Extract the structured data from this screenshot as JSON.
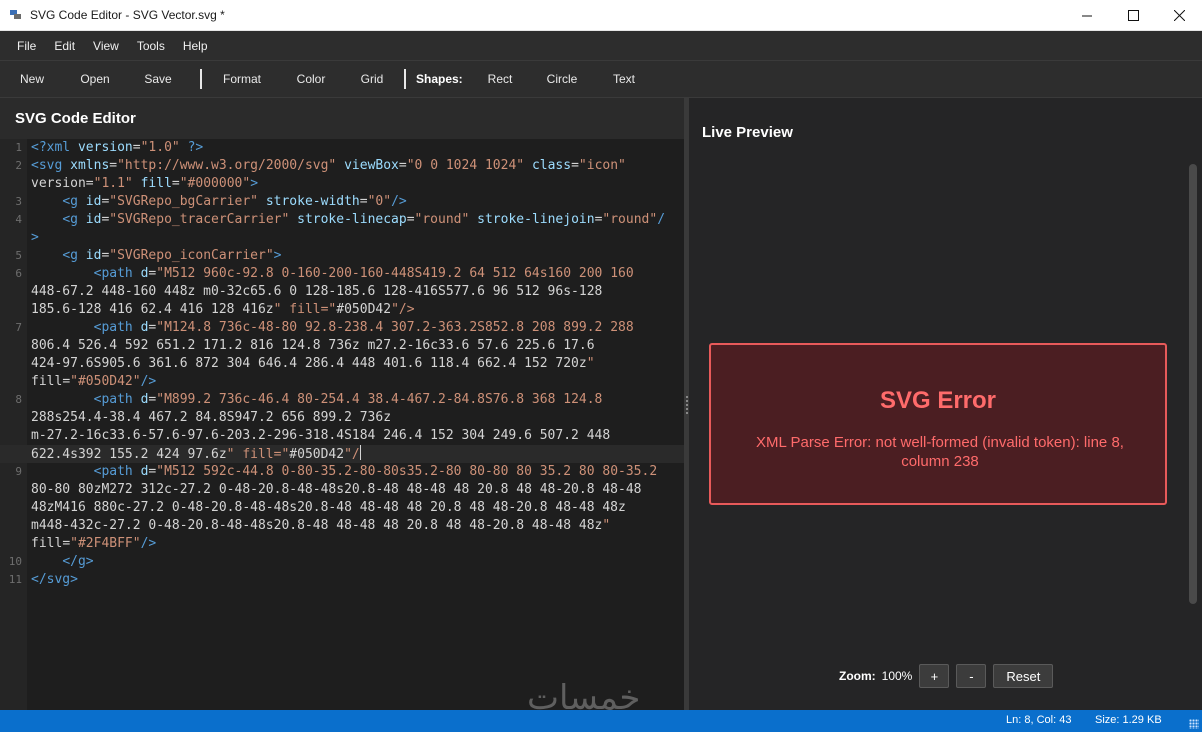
{
  "window": {
    "title": "SVG Code Editor - SVG Vector.svg *"
  },
  "menu": [
    "File",
    "Edit",
    "View",
    "Tools",
    "Help"
  ],
  "toolbar": {
    "new_label": "New",
    "open_label": "Open",
    "save_label": "Save",
    "format_label": "Format",
    "color_label": "Color",
    "grid_label": "Grid",
    "shapes_label": "Shapes:",
    "rect_label": "Rect",
    "circle_label": "Circle",
    "text_label": "Text"
  },
  "editor": {
    "title": "SVG Code Editor",
    "line_numbers": [
      "1",
      "2",
      "3",
      "4",
      "5",
      "6",
      "7",
      "8",
      "9",
      "10",
      "11"
    ],
    "lines": [
      "<?xml version=\"1.0\" ?>",
      "<svg xmlns=\"http://www.w3.org/2000/svg\" viewBox=\"0 0 1024 1024\" class=\"icon\"",
      "version=\"1.1\" fill=\"#000000\">",
      "    <g id=\"SVGRepo_bgCarrier\" stroke-width=\"0\"/>",
      "    <g id=\"SVGRepo_tracerCarrier\" stroke-linecap=\"round\" stroke-linejoin=\"round\"/",
      ">",
      "    <g id=\"SVGRepo_iconCarrier\">",
      "        <path d=\"M512 960c-92.8 0-160-200-160-448S419.2 64 512 64s160 200 160",
      "448-67.2 448-160 448z m0-32c65.6 0 128-185.6 128-416S577.6 96 512 96s-128",
      "185.6-128 416 62.4 416 128 416z\" fill=\"#050D42\"/>",
      "        <path d=\"M124.8 736c-48-80 92.8-238.4 307.2-363.2S852.8 208 899.2 288",
      "806.4 526.4 592 651.2 171.2 816 124.8 736z m27.2-16c33.6 57.6 225.6 17.6",
      "424-97.6S905.6 361.6 872 304 646.4 286.4 448 401.6 118.4 662.4 152 720z\"",
      "fill=\"#050D42\"/>",
      "        <path d=\"M899.2 736c-46.4 80-254.4 38.4-467.2-84.8S76.8 368 124.8",
      "288s254.4-38.4 467.2 84.8S947.2 656 899.2 736z",
      "m-27.2-16c33.6-57.6-97.6-203.2-296-318.4S184 246.4 152 304 249.6 507.2 448",
      "622.4s392 155.2 424 97.6z\" fill=\"#050D42\"/",
      "        <path d=\"M512 592c-44.8 0-80-35.2-80-80s35.2-80 80-80 80 35.2 80 80-35.2",
      "80-80 80zM272 312c-27.2 0-48-20.8-48-48s20.8-48 48-48 48 20.8 48 48-20.8 48-48",
      "48zM416 880c-27.2 0-48-20.8-48-48s20.8-48 48-48 48 20.8 48 48-20.8 48-48 48z",
      "m448-432c-27.2 0-48-20.8-48-48s20.8-48 48-48 48 20.8 48 48-20.8 48-48 48z\"",
      "fill=\"#2F4BFF\"/>",
      "    </g>",
      "</svg>"
    ]
  },
  "preview": {
    "title": "Live Preview",
    "error_title": "SVG Error",
    "error_message": "XML Parse Error: not well-formed (invalid token): line 8, column 238",
    "zoom_label": "Zoom:",
    "zoom_value": "100%",
    "zoom_in_label": "+",
    "zoom_out_label": "-",
    "reset_label": "Reset"
  },
  "watermark": "خمسات",
  "status": {
    "position": "Ln: 8, Col: 43",
    "size": "Size: 1.29 KB"
  },
  "colors": {
    "statusbar": "#0a6fcc",
    "error_text": "#ff6b6b",
    "error_border": "#e85a5a",
    "error_bg": "#4b1e22"
  }
}
